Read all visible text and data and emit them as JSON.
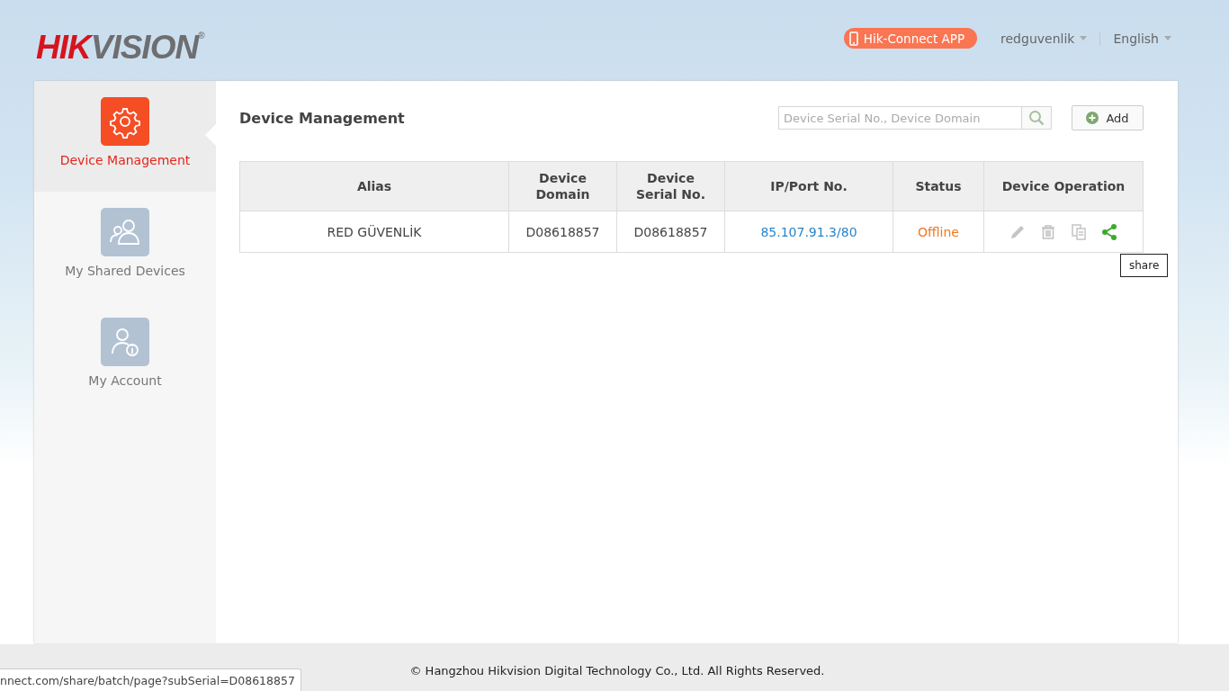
{
  "header": {
    "logo": {
      "accent": "HIK",
      "rest": "VISION",
      "mark": "®"
    },
    "app_button": "Hik-Connect APP",
    "user_menu": "redguvenlik",
    "language_menu": "English"
  },
  "sidebar": {
    "items": [
      {
        "kind": "gear",
        "label": "Device Management",
        "selected": true
      },
      {
        "kind": "users",
        "label": "My Shared Devices",
        "selected": false
      },
      {
        "kind": "account",
        "label": "My Account",
        "selected": false
      }
    ]
  },
  "page_title": "Device Management",
  "search": {
    "placeholder": "Device Serial No., Device Domain"
  },
  "add_button": "Add",
  "table": {
    "columns": [
      "Alias",
      "Device Domain",
      "Device Serial No.",
      "IP/Port No.",
      "Status",
      "Device Operation"
    ],
    "rows": [
      {
        "alias": "RED GÜVENLİK",
        "device_domain": "D08618857",
        "device_serial": "D08618857",
        "ip_port": "85.107.91.3/80",
        "status": "Offline",
        "online": false,
        "operations": [
          {
            "kind": "edit",
            "disabled": true
          },
          {
            "kind": "delete",
            "disabled": true
          },
          {
            "kind": "copy",
            "disabled": true
          },
          {
            "kind": "share",
            "disabled": false
          }
        ]
      }
    ]
  },
  "tooltip": "share",
  "footer": "© Hangzhou Hikvision Digital Technology Co., Ltd. All Rights Reserved.",
  "status_url": "nnect.com/share/batch/page?subSerial=D08618857"
}
